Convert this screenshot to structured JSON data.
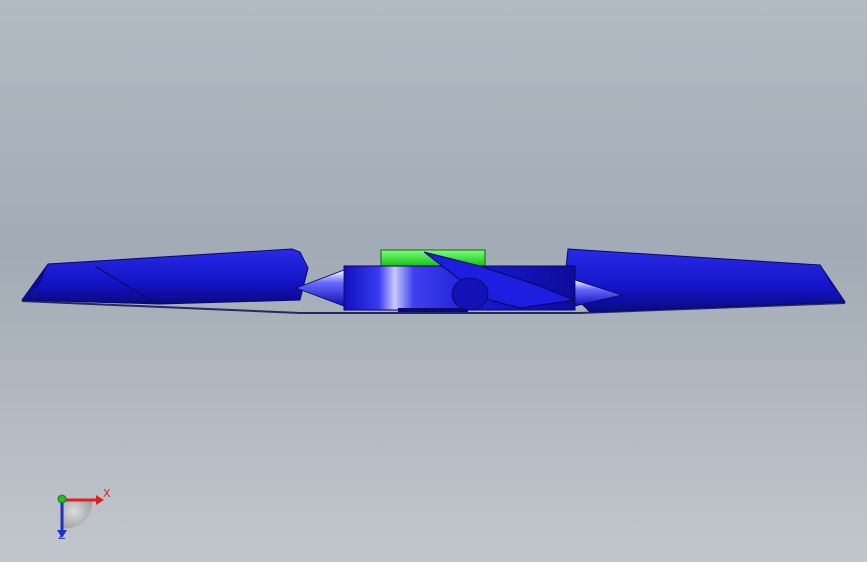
{
  "window": {
    "background_top": "#b2bac4",
    "background_bottom": "#c2c7cc"
  },
  "model": {
    "part_color": "#1a1ad8",
    "hub_cap_color": "#22e022"
  },
  "triad": {
    "x_label": "X",
    "z_label": "Z",
    "x_color": "#e02020",
    "y_color": "#20c020",
    "z_color": "#2030c0"
  }
}
